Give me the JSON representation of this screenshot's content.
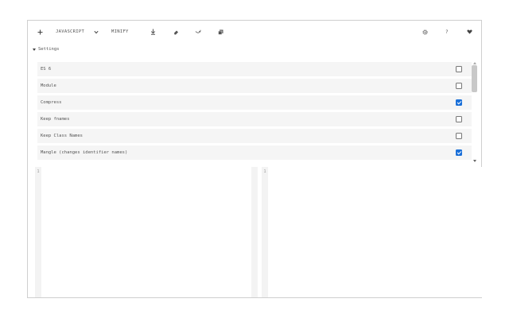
{
  "toolbar": {
    "add_icon": "plus-icon",
    "language": "JAVASCRIPT",
    "language_chevron": "chevron-down-icon",
    "mode": "MINIFY",
    "download_icon": "download-icon",
    "clear_icon": "eraser-icon",
    "wrap_icon": "undo-arrow-icon",
    "copy_icon": "copy-icon",
    "settings_icon": "gear-icon",
    "help_label": "?",
    "like_icon": "heart-icon"
  },
  "settings": {
    "toggle_label": "Settings",
    "options": [
      {
        "label": "ES 6",
        "checked": false
      },
      {
        "label": "Module",
        "checked": false
      },
      {
        "label": "Compress",
        "checked": true
      },
      {
        "label": "Keep fnames",
        "checked": false
      },
      {
        "label": "Keep Class Names",
        "checked": false
      },
      {
        "label": "Mangle (changes identifier names)",
        "checked": true
      }
    ]
  },
  "editors": {
    "input_line_number": "1",
    "output_line_number": "1"
  },
  "colors": {
    "accent": "#1a6fd8",
    "row_bg": "#f5f5f5",
    "gutter_bg": "#f3f3f3"
  }
}
